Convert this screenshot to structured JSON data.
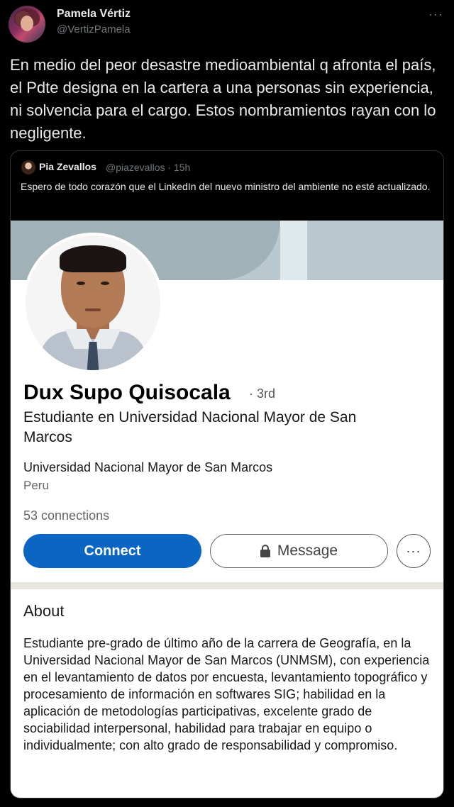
{
  "tweet": {
    "author_name": "Pamela Vértiz",
    "author_handle": "@VertizPamela",
    "more_label": "···",
    "text": "En medio del peor desastre medioambiental q afronta el país, el Pdte designa en la cartera a una personas sin experiencia, ni solvencia para el cargo. Estos nombramientos  rayan con lo negligente."
  },
  "quoted_tweet": {
    "author_name": "Pia Zevallos",
    "author_meta": "@piazevallos · 15h",
    "text": "Espero de todo corazón que el LinkedIn del nuevo ministro del ambiente no esté actualizado."
  },
  "linkedin": {
    "name": "Dux Supo Quisocala",
    "degree": "· 3rd",
    "headline": "Estudiante en Universidad Nacional Mayor de San Marcos",
    "university": "Universidad Nacional Mayor de San Marcos",
    "location": "Peru",
    "connections": "53 connections",
    "connect_label": "Connect",
    "message_label": "Message",
    "more_label": "···",
    "about_title": "About",
    "about_text": "Estudiante pre-grado de último año de la carrera de Geografía, en la Universidad Nacional Mayor de San Marcos (UNMSM), con experiencia en el levantamiento de datos por encuesta, levantamiento topográfico y procesamiento de información en softwares SIG; habilidad en la aplicación de metodologías participativas, excelente grado de sociabilidad interpersonal, habilidad para trabajar en equipo o individualmente; con alto grado de responsabilidad y compromiso."
  },
  "colors": {
    "background": "#000000",
    "text_primary": "#e7e9ea",
    "text_secondary": "#71767b",
    "linkedin_blue": "#0a66c2"
  }
}
